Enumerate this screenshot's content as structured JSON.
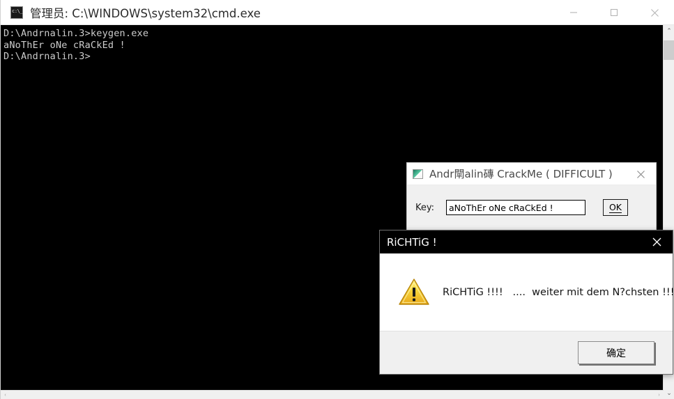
{
  "console_window": {
    "title": "管理员: C:\\WINDOWS\\system32\\cmd.exe",
    "icon": "cmd-icon",
    "output": "D:\\Andrnalin.3>keygen.exe\naNoThEr oNe cRaCkEd !\nD:\\Andrnalin.3>",
    "controls": {
      "minimize": "minimize-icon",
      "maximize": "maximize-icon",
      "close": "close-icon"
    },
    "scrollbar": {
      "up_arrow": "⌃",
      "down_arrow": "⌄",
      "left_arrow": "‹",
      "right_arrow": "›"
    },
    "background_color": "#000000",
    "text_color": "#cccccc"
  },
  "crackme_dialog": {
    "title": "Andr閛alin磚 CrackMe  ( DIFFICULT )",
    "icon": "app-icon",
    "close_icon": "close-icon",
    "key_label": "Key:",
    "key_value": "aNoThEr oNe cRaCkEd !",
    "key_placeholder": "",
    "ok_label": "OK",
    "ok_accelerator": "O"
  },
  "message_box": {
    "title": "RiCHTiG !",
    "close_icon": "close-icon",
    "icon": "warning-icon",
    "message": "RiCHTiG !!!!   ....  weiter mit dem N?chsten !!!",
    "ok_label": "确定",
    "titlebar_color": "#000000",
    "footer_color": "#f0f0f0",
    "warning_color": "#f5d020"
  }
}
